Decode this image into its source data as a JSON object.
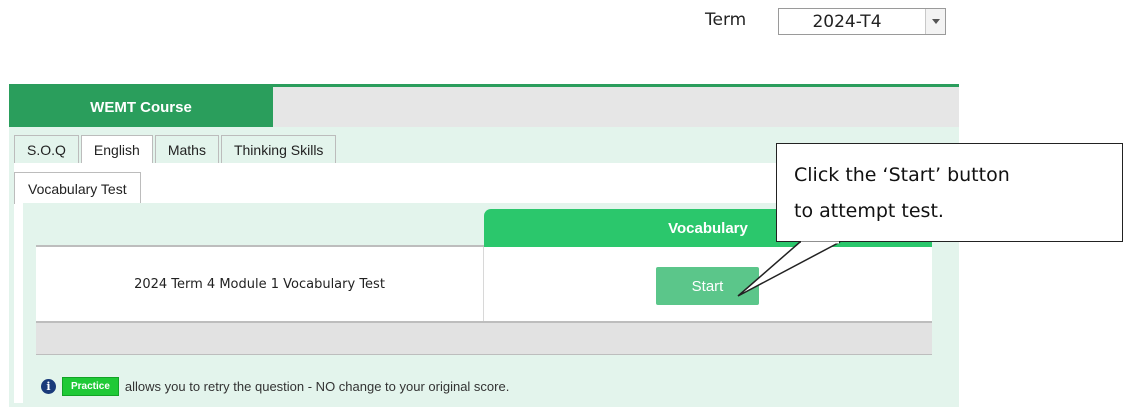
{
  "term": {
    "label": "Term",
    "selected": "2024-T4"
  },
  "course": {
    "tab_label": "WEMT Course"
  },
  "subject_tabs": [
    {
      "label": "S.O.Q"
    },
    {
      "label": "English",
      "active": true
    },
    {
      "label": "Maths"
    },
    {
      "label": "Thinking Skills"
    }
  ],
  "sub_tab": {
    "label": "Vocabulary Test"
  },
  "table": {
    "column_header": "Vocabulary",
    "rows": [
      {
        "name": "2024 Term 4 Module 1 Vocabulary Test",
        "action": "Start"
      }
    ]
  },
  "note": {
    "badge": "Practice",
    "text": "allows you to retry the question - NO change to your original score."
  },
  "callout": {
    "line1": "Click the ‘Start’ button",
    "line2": "to attempt test."
  },
  "colors": {
    "course_tab": "#2a9e5c",
    "vocab_header": "#2bc76c",
    "start_button": "#5bc68a",
    "practice_badge": "#1fc936",
    "panel_bg": "#e3f4ec"
  },
  "icons": {
    "info": "info-icon",
    "dropdown": "chevron-down-icon"
  }
}
